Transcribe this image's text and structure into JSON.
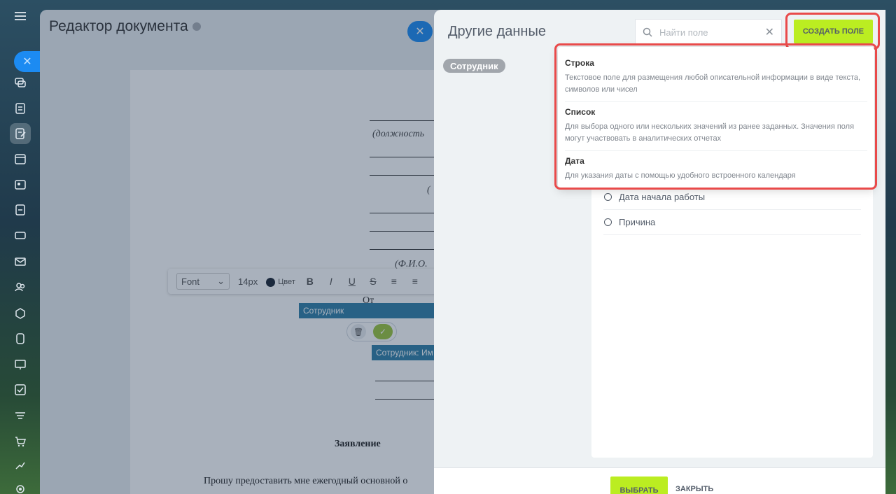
{
  "editor": {
    "title": "Редактор документа",
    "toolbar": {
      "font": "Font",
      "size": "14px",
      "color_label": "Цвет",
      "bold": "B",
      "italic": "I",
      "underline": "U",
      "strike": "S"
    },
    "doc": {
      "position_hint": "(должность",
      "fio_hint": "(Ф.И.О.",
      "bracket_hint": "(",
      "from_label": "От",
      "chip_employee": "Сотрудник",
      "chip_employee_name": "Сотрудник: Им",
      "heading": "Заявление",
      "body_start": "Прошу предоставить мне ежегодный основной о"
    }
  },
  "slider": {
    "title": "Другие данные",
    "search_placeholder": "Найти поле",
    "create_button": "СОЗДАТЬ ПОЛЕ",
    "tag": "Сотрудник",
    "fields": [
      {
        "label": "Дата начала работы"
      },
      {
        "label": "Причина"
      }
    ],
    "footer": {
      "select": "ВЫБРАТЬ",
      "close": "ЗАКРЫТЬ"
    }
  },
  "menu": {
    "items": [
      {
        "title": "Строка",
        "desc": "Текстовое поле для размещения любой описательной информации в виде текста, символов или чисел"
      },
      {
        "title": "Список",
        "desc": "Для выбора одного или нескольких значений из ранее заданных. Значения поля могут участвовать в аналитических отчетах"
      },
      {
        "title": "Дата",
        "desc": "Для указания даты с помощью удобного встроенного календаря"
      }
    ]
  },
  "colors": {
    "accent_green": "#bbed21",
    "highlight_red": "#e94a4a",
    "blue_button": "#1c8bf2"
  }
}
